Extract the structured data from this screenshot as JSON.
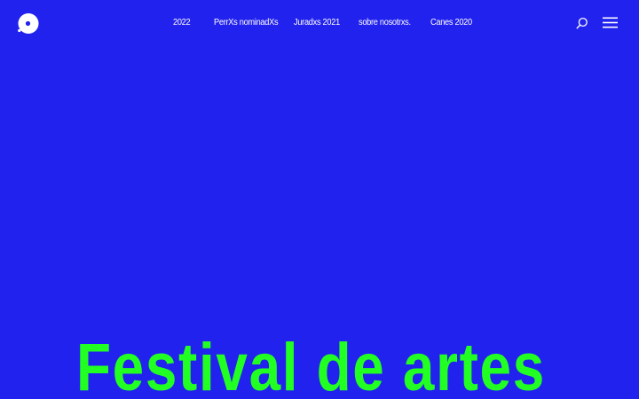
{
  "brand": {
    "logo_icon": "circle-logo-icon",
    "background_color": "#2222ee",
    "accent_color": "#22ff22",
    "text_color": "#ffffff"
  },
  "nav": {
    "items": [
      {
        "label": "2022"
      },
      {
        "label": "PerrXs nominadXs"
      },
      {
        "label": "Juradxs 2021"
      },
      {
        "label": "sobre nosotrxs."
      },
      {
        "label": "Canes 2020"
      }
    ]
  },
  "header": {
    "search_icon": "search-icon",
    "menu_icon": "hamburger-menu-icon"
  },
  "hero": {
    "title": "Festival de artes"
  }
}
